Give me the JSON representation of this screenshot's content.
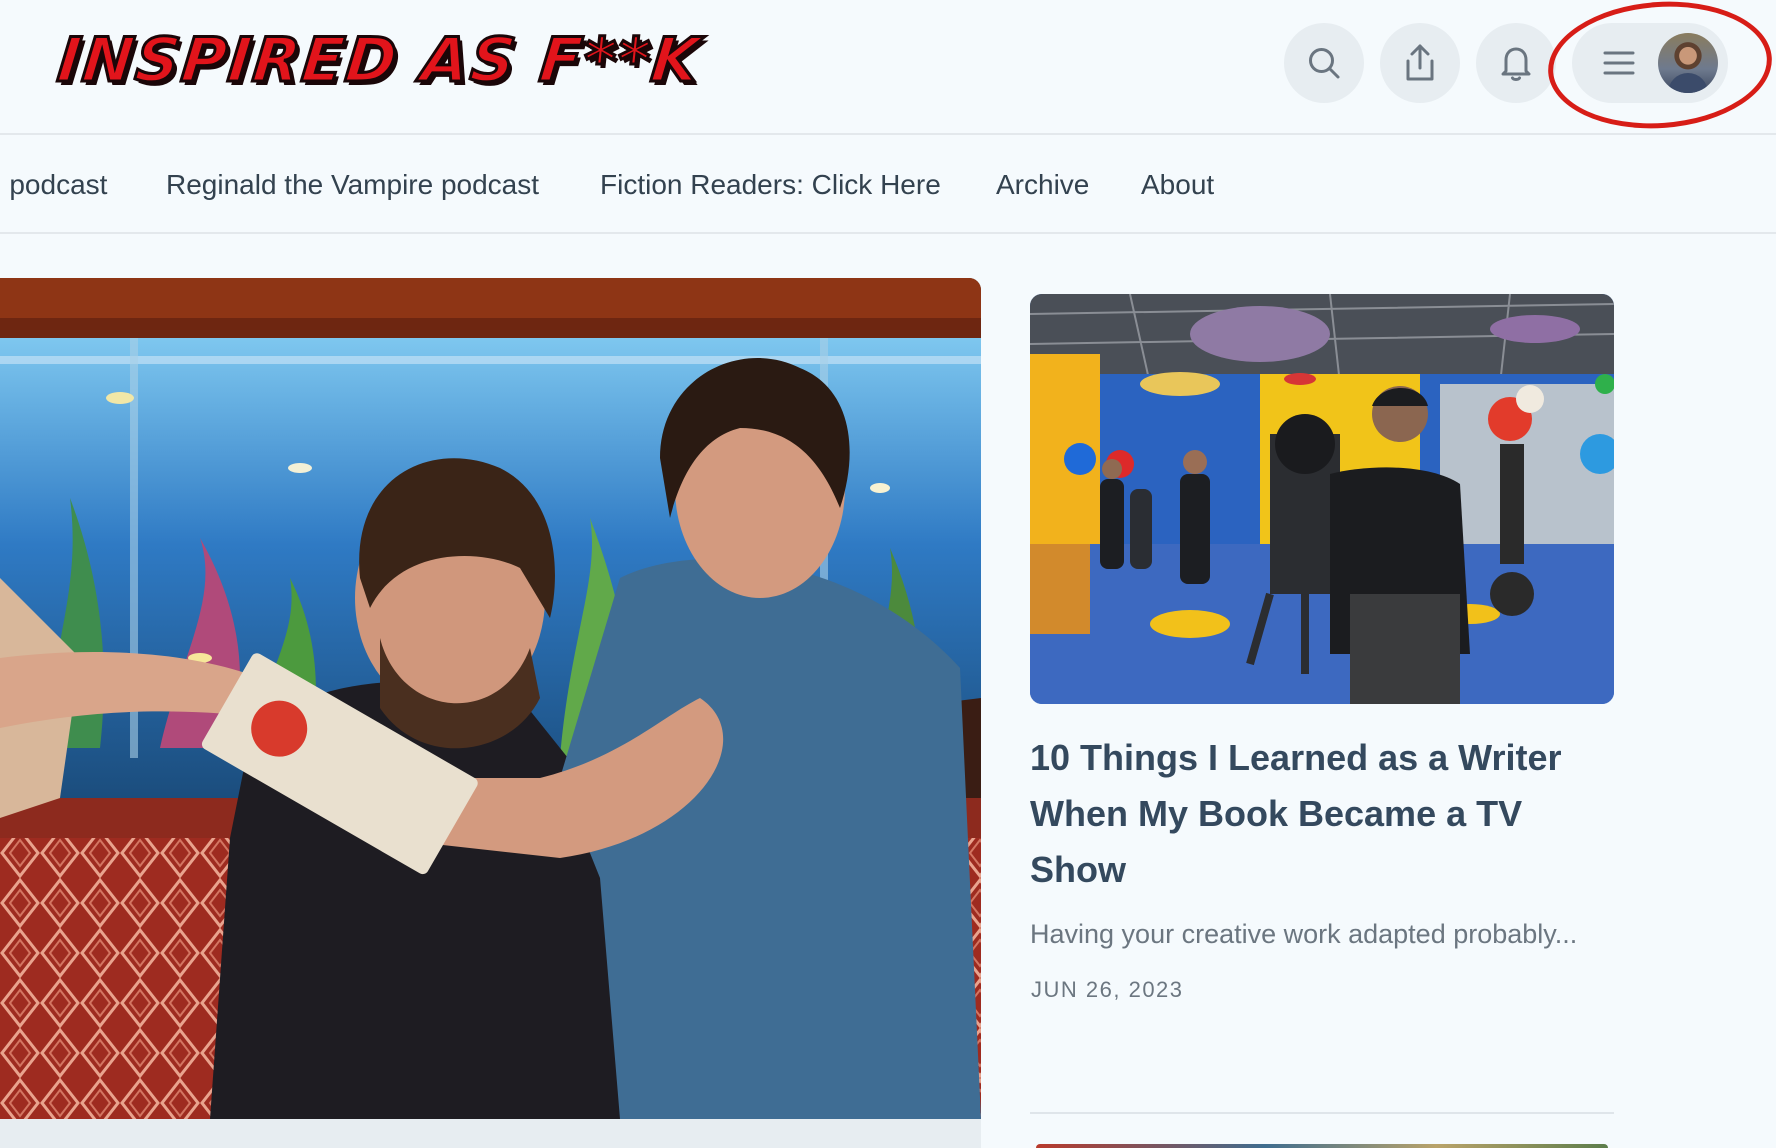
{
  "header": {
    "logo_text": "INSPIRED AS F**K",
    "search_icon": "search-icon",
    "share_icon": "share-icon",
    "bell_icon": "bell-icon",
    "menu_icon": "menu-icon",
    "avatar": "profile-avatar"
  },
  "nav": {
    "items": [
      {
        "label": "g podcast"
      },
      {
        "label": "Reginald the Vampire podcast"
      },
      {
        "label": "Fiction Readers: Click Here"
      },
      {
        "label": "Archive"
      },
      {
        "label": "About"
      }
    ]
  },
  "featured": {
    "image": "hero-photo-two-men-aquarium"
  },
  "sidebar_post": {
    "image": "tv-set-photo",
    "title": "10 Things I Learned as a Writer When My Book Became a TV Show",
    "excerpt": "Having your creative work adapted probably...",
    "date": "JUN 26, 2023"
  },
  "colors": {
    "background": "#f5fafd",
    "logo_red": "#e2141b",
    "annotation_red": "#d71d17",
    "title_text": "#34495e",
    "muted_text": "#6b7680",
    "button_bg": "#e7edf1"
  }
}
